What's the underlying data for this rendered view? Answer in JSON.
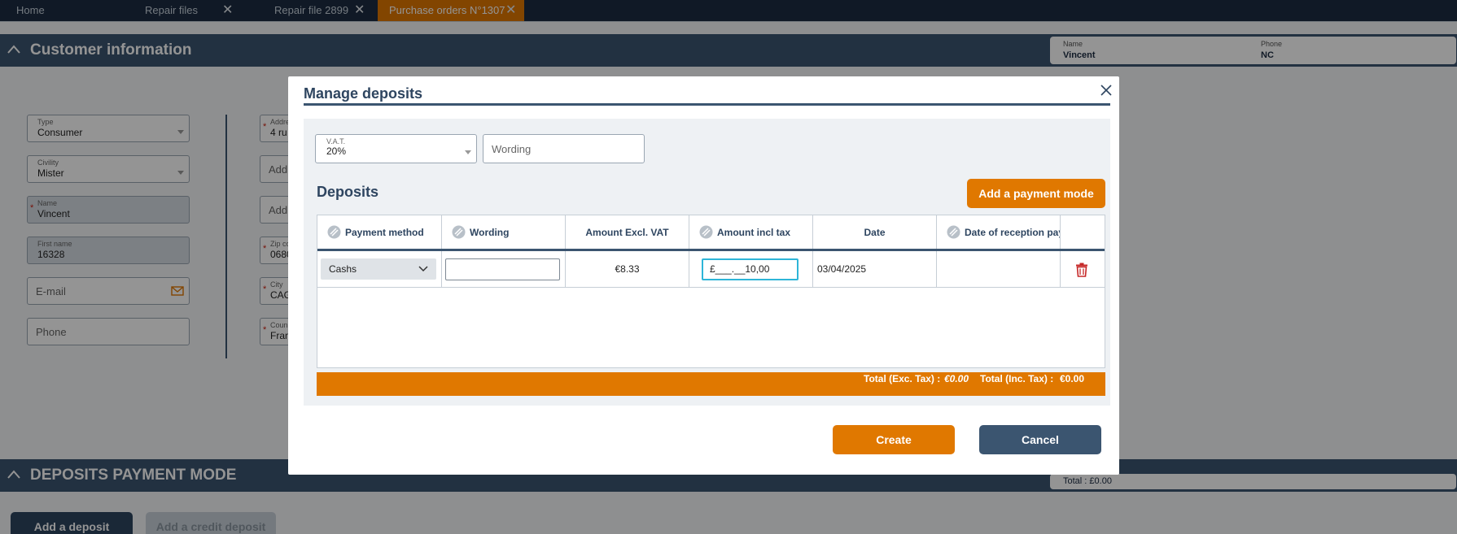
{
  "tabs": [
    {
      "label": "Home"
    },
    {
      "label": "Repair files",
      "close": "✕"
    },
    {
      "label": "Repair file 2899",
      "close": "✕"
    },
    {
      "label": "Purchase orders N°1307",
      "close": "✕",
      "active": true
    }
  ],
  "customer_section": {
    "title": "Customer information",
    "summary": {
      "name_label": "Name",
      "name_value": "Vincent",
      "phone_label": "Phone",
      "phone_value": "NC"
    }
  },
  "form": {
    "type": {
      "label": "Type",
      "value": "Consumer"
    },
    "civility": {
      "label": "Civility",
      "value": "Mister"
    },
    "name": {
      "label": "Name",
      "value": "Vincent"
    },
    "first_name": {
      "label": "First name",
      "value": "16328"
    },
    "email": {
      "placeholder": "E-mail"
    },
    "phone": {
      "placeholder": "Phone"
    },
    "address1": {
      "label": "Addre",
      "value": "4 ru"
    },
    "address2": {
      "placeholder": "Add"
    },
    "address3": {
      "placeholder": "Add"
    },
    "zip": {
      "label": "Zip co",
      "value": "0680"
    },
    "city": {
      "label": "City",
      "value": "CAG"
    },
    "country": {
      "label": "Coun",
      "value": "Fran"
    }
  },
  "deposits_section": {
    "title": "DEPOSITS PAYMENT MODE",
    "total": "Total : £0.00"
  },
  "bottom_buttons": {
    "add_deposit": "Add a deposit",
    "add_credit_deposit": "Add a credit deposit"
  },
  "modal": {
    "title": "Manage deposits",
    "close": "✕",
    "vat": {
      "label": "V.A.T.",
      "value": "20%"
    },
    "wording_placeholder": "Wording",
    "deposits_title": "Deposits",
    "add_payment_mode": "Add a payment mode",
    "table": {
      "headers": [
        "Payment method",
        "Wording",
        "Amount Excl. VAT",
        "Amount incl tax",
        "Date",
        "Date of reception pay"
      ],
      "row": {
        "payment_method": "Cashs",
        "wording": "",
        "amount_excl": "€8.33",
        "amount_incl": "£___.__10,00",
        "date": "03/04/2025",
        "reception_date": ""
      }
    },
    "totals": {
      "exc_label": "Total (Exc. Tax) :",
      "exc_value": "€0.00",
      "inc_label": "Total (Inc. Tax) :",
      "inc_value": "€0.00"
    },
    "create": "Create",
    "cancel": "Cancel"
  },
  "colors": {
    "accent": "#e07800",
    "primary": "#3b5570",
    "dark": "#1c2c42",
    "focus": "#2eb5d8",
    "danger": "#c62828"
  }
}
